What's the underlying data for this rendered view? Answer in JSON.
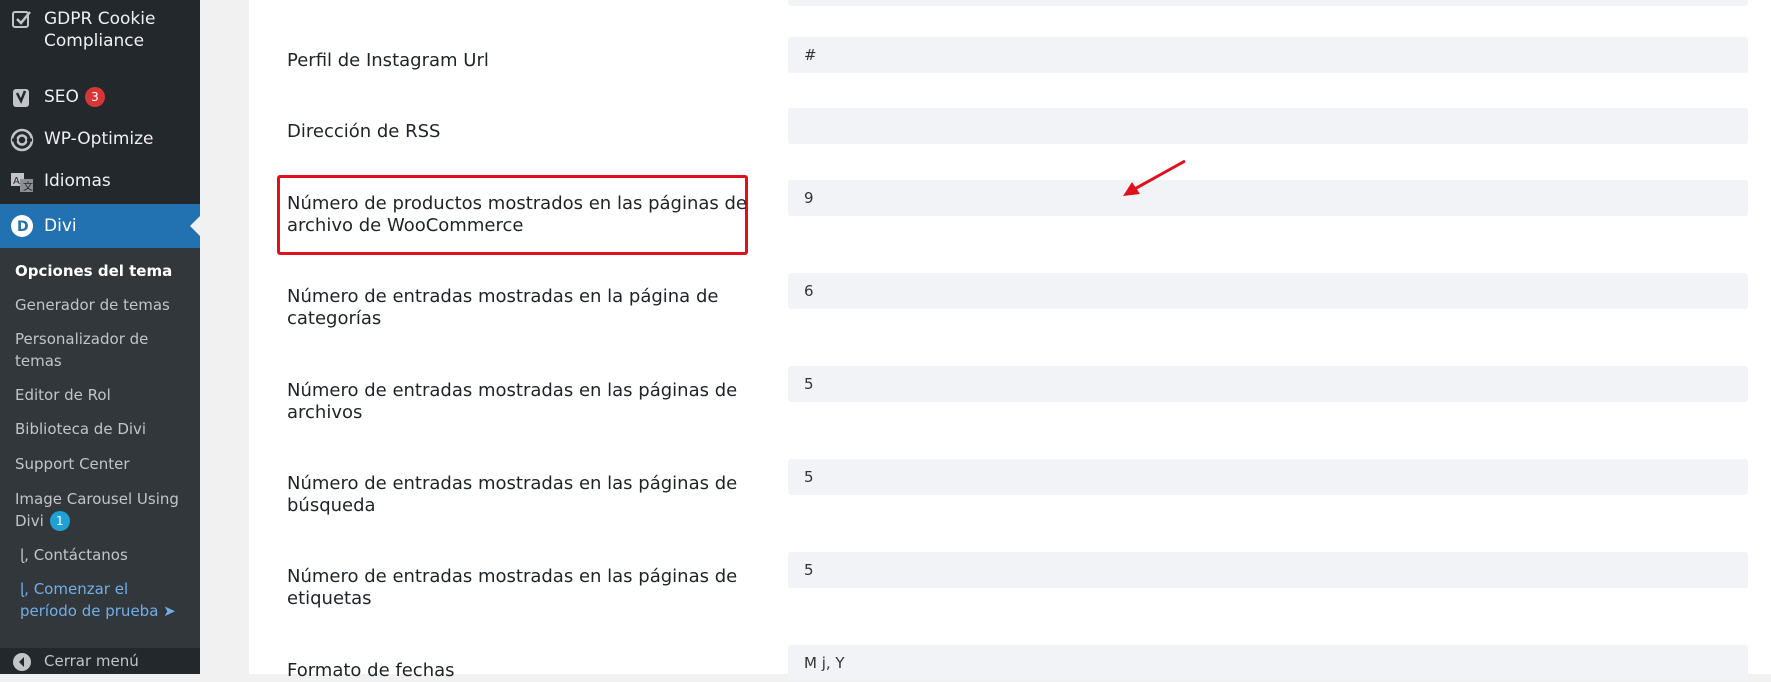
{
  "sidebar": {
    "menu": [
      {
        "label": "GDPR Cookie Compliance",
        "icon": "checkbox-icon"
      },
      {
        "label": "SEO",
        "icon": "yoast-icon",
        "badge": "3"
      },
      {
        "label": "WP-Optimize",
        "icon": "optimize-icon"
      },
      {
        "label": "Idiomas",
        "icon": "translate-icon"
      },
      {
        "label": "Divi",
        "icon": "divi-icon"
      }
    ],
    "submenu": [
      {
        "label": "Opciones del tema"
      },
      {
        "label": "Generador de temas"
      },
      {
        "label": "Personalizador de temas"
      },
      {
        "label": "Editor de Rol"
      },
      {
        "label": "Biblioteca de Divi"
      },
      {
        "label": "Support Center"
      },
      {
        "label": "Image Carousel Using Divi",
        "badge": "1"
      },
      {
        "label": "ɭ, Contáctanos"
      },
      {
        "label": "ɭ, Comenzar el período de prueba ➤"
      }
    ],
    "collapse_label": "Cerrar menú"
  },
  "settings": [
    {
      "label": "Perfil de Instagram Url",
      "value": "#"
    },
    {
      "label": "Dirección de RSS",
      "value": ""
    },
    {
      "label": "Número de productos mostrados en las páginas de archivo de WooCommerce",
      "value": "9"
    },
    {
      "label": "Número de entradas mostradas en la página de categorías",
      "value": "6"
    },
    {
      "label": "Número de entradas mostradas en las páginas de archivos",
      "value": "5"
    },
    {
      "label": "Número de entradas mostradas en las páginas de búsqueda",
      "value": "5"
    },
    {
      "label": "Número de entradas mostradas en las páginas de etiquetas",
      "value": "5"
    },
    {
      "label": "Formato de fechas",
      "value": "M j, Y"
    }
  ],
  "colors": {
    "sidebar_bg": "#23282d",
    "active_menu": "#2271b1",
    "annotation_red": "#e0101c",
    "badge_red": "#d63638",
    "badge_blue": "#1fa0d6"
  }
}
